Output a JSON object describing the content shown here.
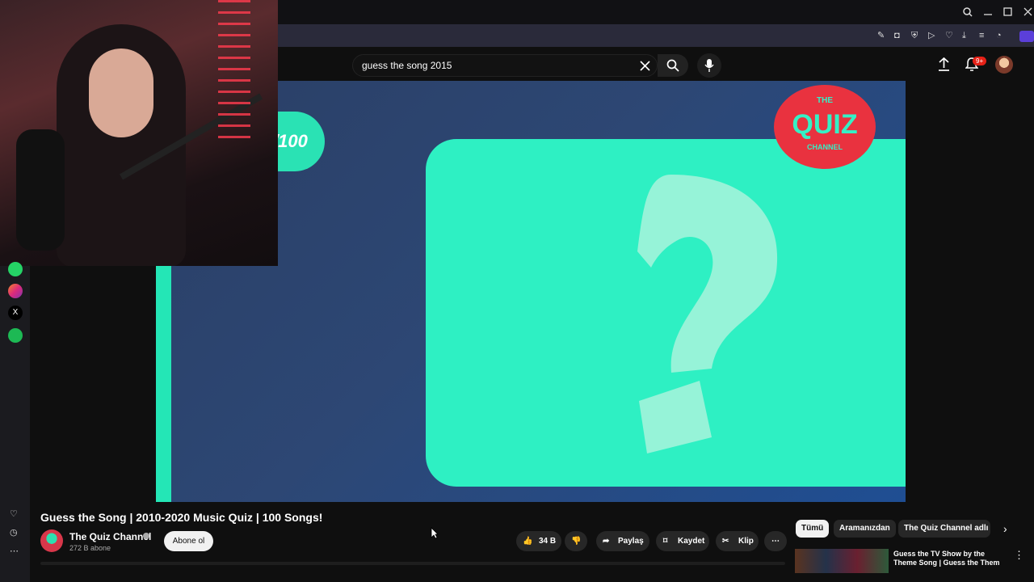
{
  "search": {
    "query": "guess the song 2015"
  },
  "notifications": {
    "count": "9+"
  },
  "video": {
    "title": "Guess the Song | 2010-2020 Music Quiz | 100 Songs!",
    "overlay_score": "/100",
    "logo_line1": "THE",
    "logo_line2": "QUIZ",
    "logo_line3": "CHANNEL"
  },
  "channel": {
    "name": "The Quiz Channel",
    "subscribers": "272 B abone",
    "subscribe_label": "Abone ol"
  },
  "actions": {
    "likes": "34 B",
    "share": "Paylaş",
    "save": "Kaydet",
    "clip": "Klip"
  },
  "chips": [
    "Tümü",
    "Aramanızdan",
    "The Quiz Channel adlı y"
  ],
  "recommended": {
    "title": "Guess the TV Show by the Theme Song | Guess the Them"
  },
  "colors": {
    "accent_cyan": "#2ef0c3",
    "logo_red": "#e9323f",
    "notif_red": "#e62117"
  }
}
